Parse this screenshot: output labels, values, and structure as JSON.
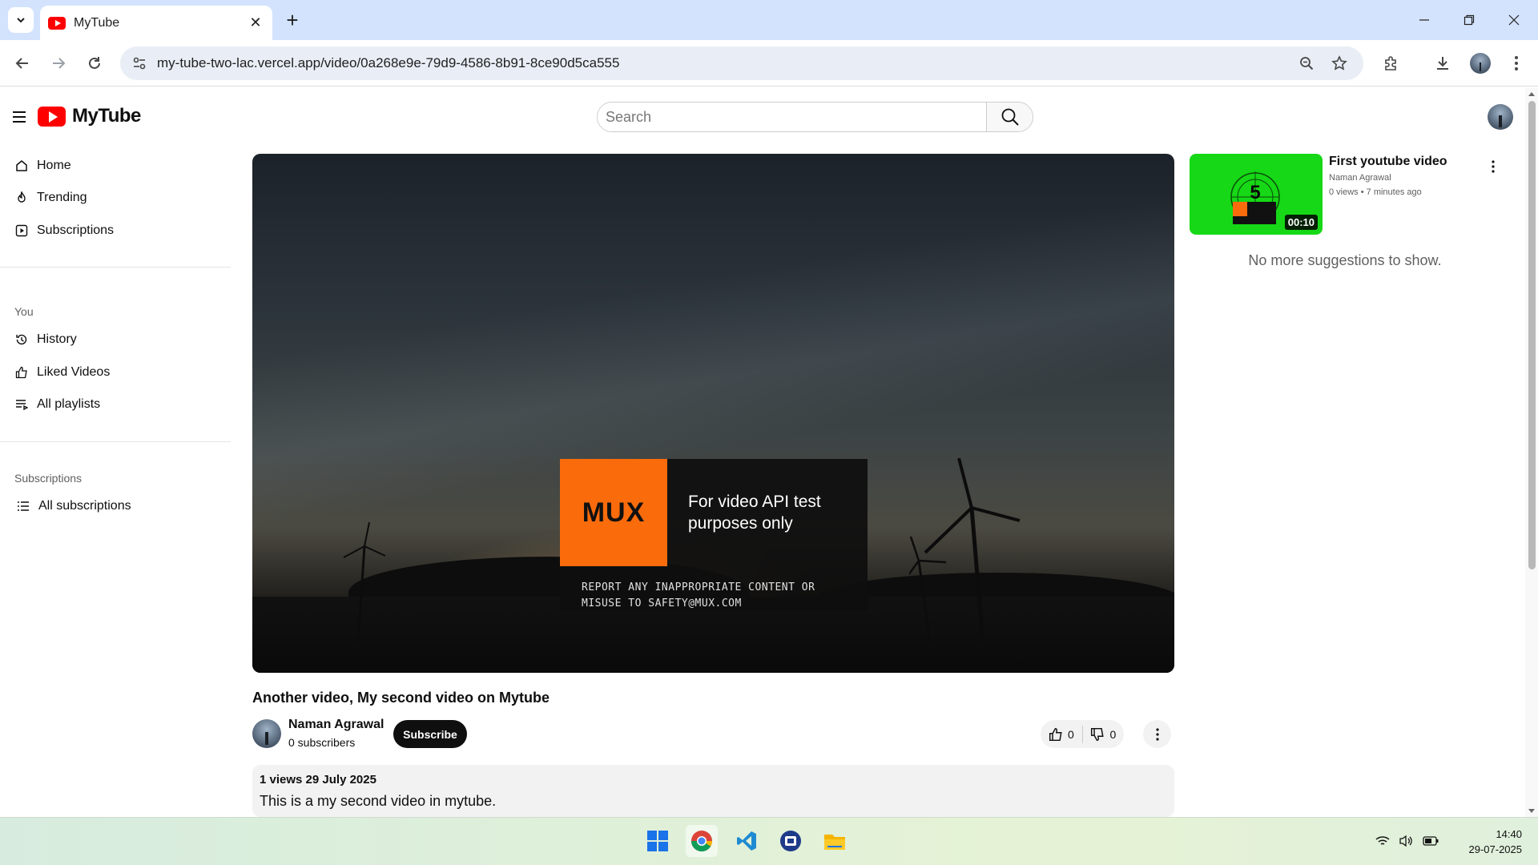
{
  "browser": {
    "tab_title": "MyTube",
    "url": "my-tube-two-lac.vercel.app/video/0a268e9e-79d9-4586-8b91-8ce90d5ca555"
  },
  "app": {
    "name": "MyTube",
    "search_placeholder": "Search"
  },
  "sidebar": {
    "main": [
      {
        "label": "Home",
        "icon": "home-icon"
      },
      {
        "label": "Trending",
        "icon": "flame-icon"
      },
      {
        "label": "Subscriptions",
        "icon": "subscriptions-icon"
      }
    ],
    "you_heading": "You",
    "you": [
      {
        "label": "History",
        "icon": "history-icon"
      },
      {
        "label": "Liked Videos",
        "icon": "thumbs-up-icon"
      },
      {
        "label": "All playlists",
        "icon": "playlist-icon"
      }
    ],
    "subs_heading": "Subscriptions",
    "subs": [
      {
        "label": "All subscriptions",
        "icon": "list-icon"
      }
    ]
  },
  "player": {
    "mux_logo": "MUX",
    "mux_tagline": "For video API test purposes only",
    "mux_report": "REPORT ANY INAPPROPRIATE CONTENT OR MISUSE TO SAFETY@MUX.COM"
  },
  "video": {
    "title": "Another video, My second video on Mytube",
    "channel": "Naman Agrawal",
    "subscribers": "0 subscribers",
    "subscribe_label": "Subscribe",
    "likes": "0",
    "dislikes": "0",
    "meta": "1 views 29 July 2025",
    "description": "This is a my second video in mytube."
  },
  "suggestions": {
    "items": [
      {
        "title": "First youtube video",
        "channel": "Naman Agrawal",
        "meta": "0 views • 7 minutes ago",
        "duration": "00:10"
      }
    ],
    "no_more": "No more suggestions to show."
  },
  "taskbar": {
    "time": "14:40",
    "date": "29-07-2025"
  },
  "colors": {
    "brand_red": "#ff0000",
    "mux_orange": "#fa6b0c",
    "thumb_green": "#16d816"
  }
}
